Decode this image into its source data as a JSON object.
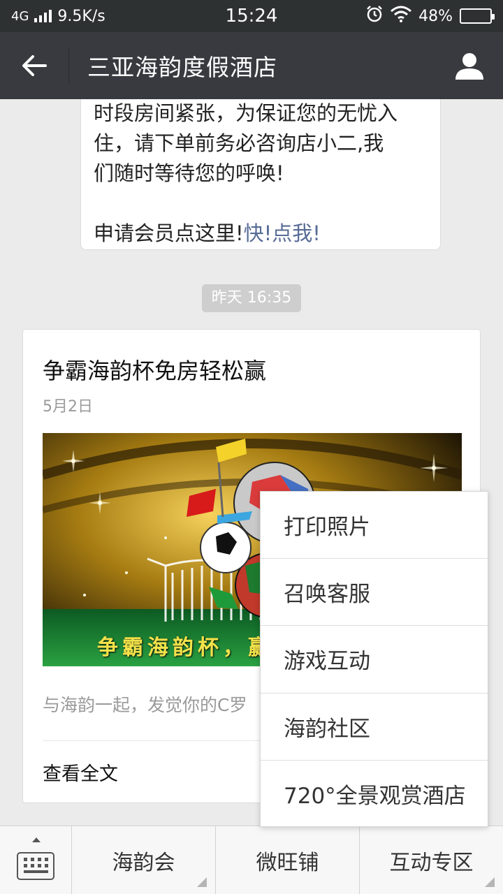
{
  "status_bar": {
    "network": "4G",
    "speed": "9.5K/s",
    "time": "15:24",
    "battery": "48%",
    "battery_level": 0.48
  },
  "header": {
    "title": "三亚海韵度假酒店",
    "icons": [
      "back-arrow-icon",
      "profile-icon"
    ]
  },
  "chat": {
    "message": {
      "lines": [
        "时段房间紧张，为保证您的无忧入",
        "住，请下单前务必咨询店小二,我",
        "们随时等待您的呼唤!"
      ],
      "member_text": "申请会员点这里!",
      "member_link": "快!点我!"
    },
    "timestamp": "昨天 16:35",
    "article": {
      "title": "争霸海韵杯免房轻松赢",
      "date": "5月2日",
      "cover_caption": "争霸海韵杯，赢",
      "summary": "与海韵一起，发觉你的C罗",
      "read_more": "查看全文"
    }
  },
  "popup_menu": {
    "items": [
      "打印照片",
      "召唤客服",
      "游戏互动",
      "海韵社区",
      "720°全景观赏酒店"
    ]
  },
  "bottom_menu": {
    "tabs": [
      "海韵会",
      "微旺铺",
      "互动专区"
    ]
  },
  "colors": {
    "title_bar": "#393a3f",
    "status_bar": "#2e3132",
    "link": "#576b95",
    "chat_bg": "#ebebeb"
  }
}
